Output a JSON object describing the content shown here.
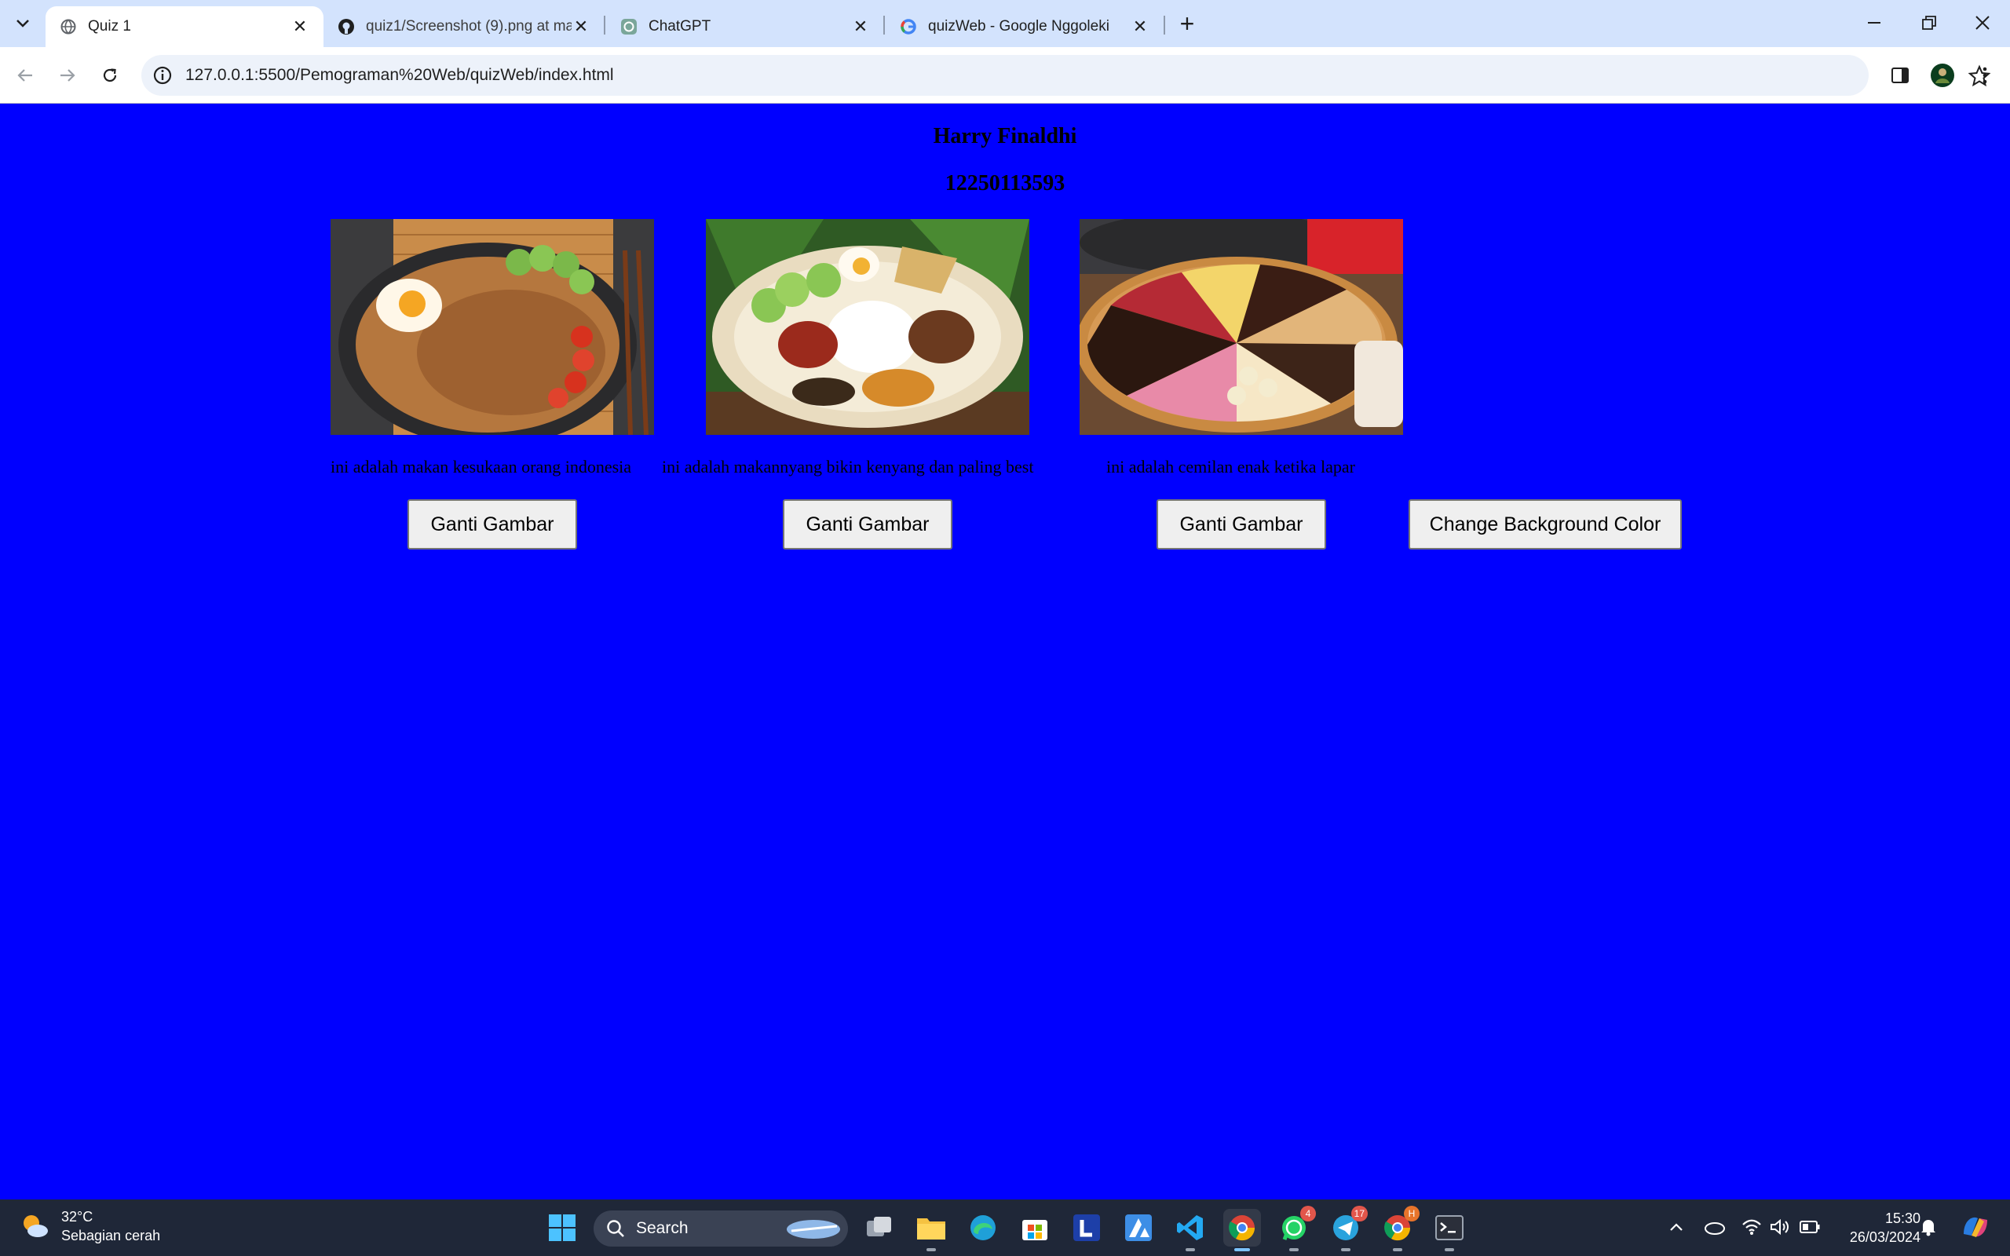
{
  "browser": {
    "tabs": [
      {
        "title": "Quiz 1",
        "active": true,
        "favicon": "globe-icon"
      },
      {
        "title": "quiz1/Screenshot (9).png at ma",
        "active": false,
        "favicon": "github-icon"
      },
      {
        "title": "ChatGPT",
        "active": false,
        "favicon": "chatgpt-icon"
      },
      {
        "title": "quizWeb - Google Nggoleki",
        "active": false,
        "favicon": "google-icon"
      }
    ],
    "url": "127.0.0.1:5500/Pemograman%20Web/quizWeb/index.html"
  },
  "page": {
    "background_color": "#0000ff",
    "name": "Harry Finaldhi",
    "nim": "12250113593",
    "cards": [
      {
        "caption": "ini adalah makan kesukaan orang indonesia",
        "button": "Ganti Gambar",
        "image": "nasi-goreng-photo"
      },
      {
        "caption": "ini adalah makannyang bikin kenyang dan paling best",
        "button": "Ganti Gambar",
        "image": "nasi-lemak-photo"
      },
      {
        "caption": "ini adalah cemilan enak ketika lapar",
        "button": "Ganti Gambar",
        "image": "martabak-manis-photo"
      }
    ],
    "bg_button": "Change Background Color"
  },
  "taskbar": {
    "weather": {
      "temp": "32°C",
      "desc": "Sebagian cerah"
    },
    "search_label": "Search",
    "time": "15:30",
    "date": "26/03/2024",
    "badges": {
      "whatsapp": "4",
      "telegram": "17",
      "chrome2": "H"
    }
  }
}
